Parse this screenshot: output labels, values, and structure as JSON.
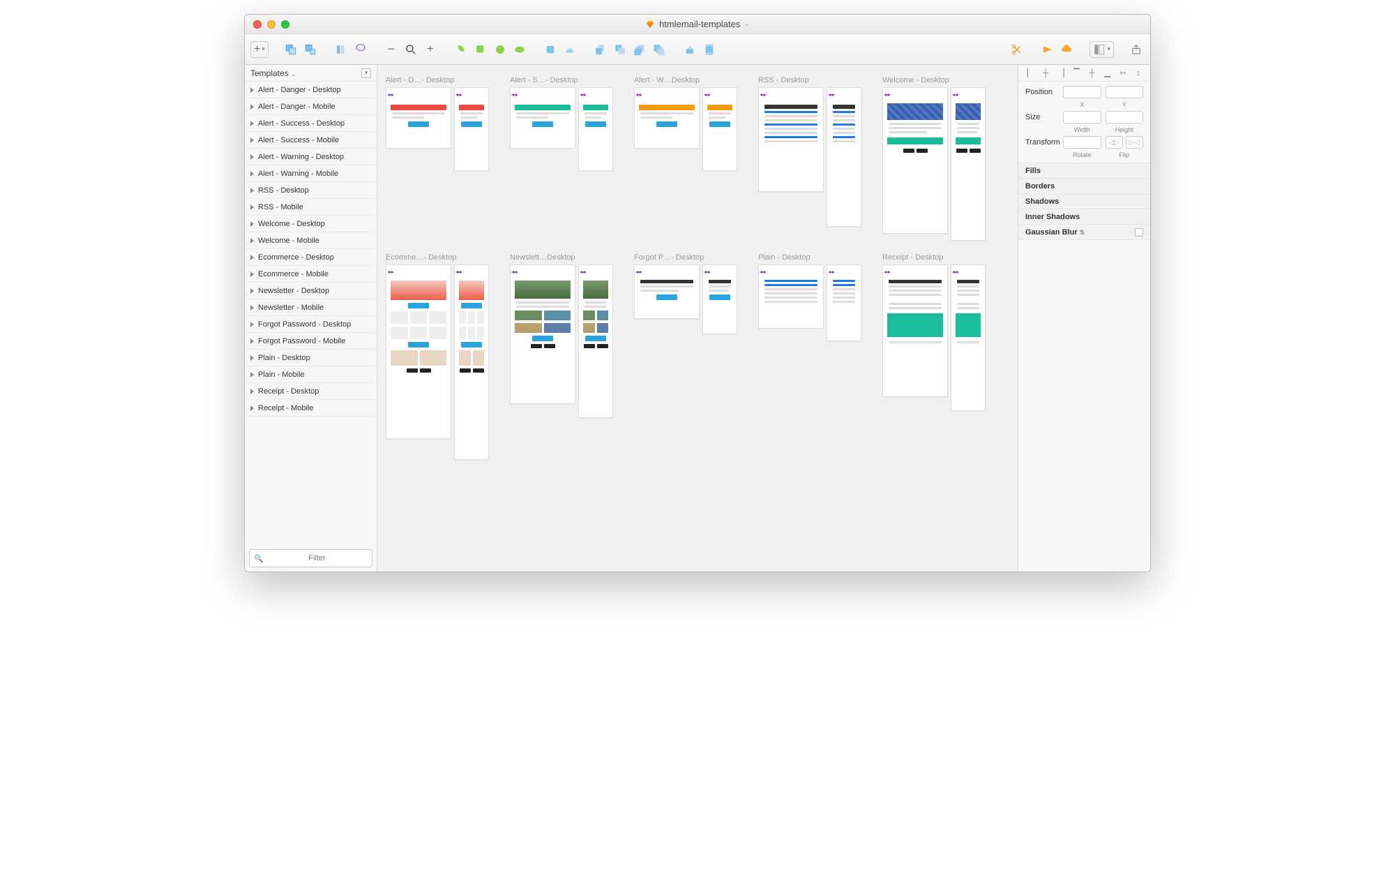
{
  "title": "htmlemail-templates",
  "sidebar": {
    "header": "Templates",
    "filter_placeholder": "Filter",
    "items": [
      "Alert - Danger - Desktop",
      "Alert - Danger - Mobile",
      "Alert - Success - Desktop",
      "Alert - Success - Mobile",
      "Alert - Warning - Desktop",
      "Alert - Warning - Mobile",
      "RSS - Desktop",
      "RSS - Mobile",
      "Welcome - Desktop",
      "Welcome - Mobile",
      "Ecommerce - Desktop",
      "Ecommerce - Mobile",
      "Newsletter - Desktop",
      "Newsletter - Mobile",
      "Forgot Password - Desktop",
      "Forgot Password - Mobile",
      "Plain - Desktop",
      "Plain - Mobile",
      "Receipt - Desktop",
      "Receipt - Mobile"
    ]
  },
  "artboards": {
    "row1": [
      {
        "label": "Alert - D…- Desktop",
        "accent": "#e74c3c",
        "height_d": 88,
        "height_m": 120
      },
      {
        "label": "Alert - S…- Desktop",
        "accent": "#1bbc9c",
        "height_d": 88,
        "height_m": 120
      },
      {
        "label": "Alert - W…Desktop",
        "accent": "#f39c12",
        "height_d": 88,
        "height_m": 120
      },
      {
        "label": "RSS - Desktop",
        "accent": "#ffffff",
        "height_d": 150,
        "height_m": 200
      },
      {
        "label": "Welcome - Desktop",
        "accent": "#ffffff",
        "height_d": 210,
        "height_m": 220
      }
    ],
    "row2": [
      {
        "label": "Ecomme…- Desktop",
        "height_d": 250,
        "height_m": 280
      },
      {
        "label": "Newslett…Desktop",
        "height_d": 200,
        "height_m": 220
      },
      {
        "label": "Forgot P…- Desktop",
        "height_d": 78,
        "height_m": 100
      },
      {
        "label": "Plain - Desktop",
        "height_d": 92,
        "height_m": 110
      },
      {
        "label": "Receipt - Desktop",
        "height_d": 190,
        "height_m": 210
      }
    ]
  },
  "inspector": {
    "position": "Position",
    "size": "Size",
    "transform": "Transform",
    "x": "X",
    "y": "Y",
    "width": "Width",
    "height": "Height",
    "rotate": "Rotate",
    "flip": "Flip",
    "sections": [
      "Fills",
      "Borders",
      "Shadows",
      "Inner Shadows"
    ],
    "gauss": "Gaussian Blur"
  }
}
